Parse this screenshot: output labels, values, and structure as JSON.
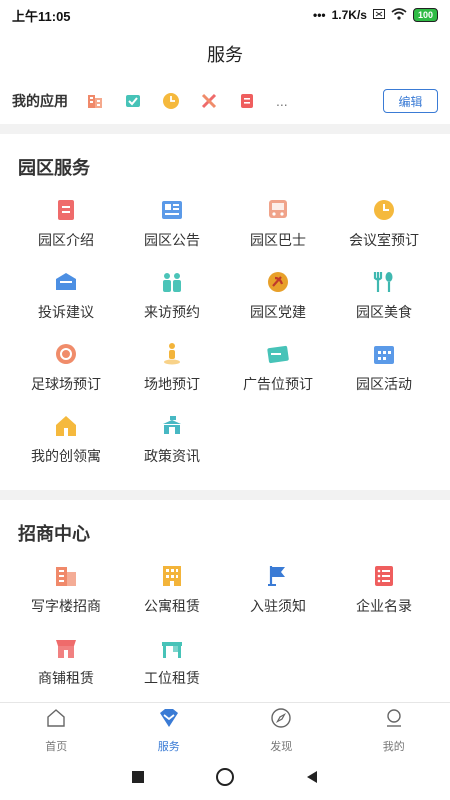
{
  "status_bar": {
    "time": "上午11:05",
    "dots": "•••",
    "speed": "1.7K/s",
    "battery": "100"
  },
  "header": {
    "title": "服务"
  },
  "my_apps": {
    "label": "我的应用",
    "icons": [
      "building-icon",
      "checkbox-icon",
      "clock-icon",
      "tools-icon",
      "document-icon"
    ],
    "more": "...",
    "edit_label": "编辑"
  },
  "park_services": {
    "title": "园区服务",
    "items": [
      {
        "label": "园区介绍",
        "icon": "document-icon",
        "color": "#ef6b6b"
      },
      {
        "label": "园区公告",
        "icon": "newspaper-icon",
        "color": "#5b9ae8"
      },
      {
        "label": "园区巴士",
        "icon": "bus-icon",
        "color": "#f0a38a"
      },
      {
        "label": "会议室预订",
        "icon": "clock-icon",
        "color": "#f5b93d"
      },
      {
        "label": "投诉建议",
        "icon": "mail-icon",
        "color": "#4c8fe3"
      },
      {
        "label": "来访预约",
        "icon": "people-icon",
        "color": "#4bc4b8"
      },
      {
        "label": "园区党建",
        "icon": "party-emblem-icon",
        "color": "#e8a02a"
      },
      {
        "label": "园区美食",
        "icon": "cutlery-icon",
        "color": "#3fb8b0"
      },
      {
        "label": "足球场预订",
        "icon": "football-icon",
        "color": "#f08c6a"
      },
      {
        "label": "场地预订",
        "icon": "location-person-icon",
        "color": "#f3b43a"
      },
      {
        "label": "广告位预订",
        "icon": "card-icon",
        "color": "#47c3b8"
      },
      {
        "label": "园区活动",
        "icon": "calendar-icon",
        "color": "#5b9ae8"
      },
      {
        "label": "我的创领寓",
        "icon": "house-icon",
        "color": "#f5b93d"
      },
      {
        "label": "政策资讯",
        "icon": "podium-icon",
        "color": "#47b8c3"
      }
    ]
  },
  "investment_center": {
    "title": "招商中心",
    "items": [
      {
        "label": "写字楼招商",
        "icon": "office-building-icon",
        "color": "#f0896a"
      },
      {
        "label": "公寓租赁",
        "icon": "apartment-icon",
        "color": "#f3b43a"
      },
      {
        "label": "入驻须知",
        "icon": "flag-icon",
        "color": "#3a7bd5"
      },
      {
        "label": "企业名录",
        "icon": "list-icon",
        "color": "#ef5e5e"
      },
      {
        "label": "商铺租赁",
        "icon": "shop-icon",
        "color": "#ef6b6b"
      },
      {
        "label": "工位租赁",
        "icon": "desk-icon",
        "color": "#47c3b8"
      }
    ]
  },
  "tabs": [
    {
      "label": "首页",
      "icon": "home-icon",
      "active": false
    },
    {
      "label": "服务",
      "icon": "service-icon",
      "active": true
    },
    {
      "label": "发现",
      "icon": "compass-icon",
      "active": false
    },
    {
      "label": "我的",
      "icon": "user-icon",
      "active": false
    }
  ],
  "colors": {
    "accent": "#3a7bd5",
    "divider": "#f2f2f2"
  }
}
